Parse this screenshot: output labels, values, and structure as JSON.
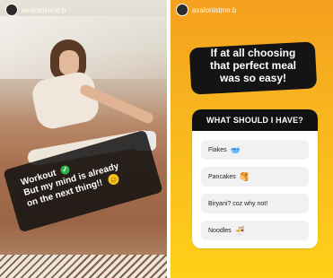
{
  "left_story": {
    "username": "avalonistme.b",
    "caption_lines": [
      "Workout",
      "But my mind is already",
      "on the next thing!!"
    ],
    "icons": {
      "check": "check-icon",
      "smile": "smile-icon"
    }
  },
  "right_story": {
    "username": "avalonistme.b",
    "headline_lines": [
      "If at all choosing",
      "that perfect meal",
      "was so easy!"
    ],
    "question": {
      "title": "WHAT SHOULD I HAVE?",
      "options": [
        {
          "label": "Flakes",
          "emoji": "🥣"
        },
        {
          "label": "Pancakes",
          "emoji": "🥞"
        },
        {
          "label": "Biryani? coz why not!",
          "emoji": ""
        },
        {
          "label": "Noodles",
          "emoji": "🍜"
        }
      ]
    }
  }
}
